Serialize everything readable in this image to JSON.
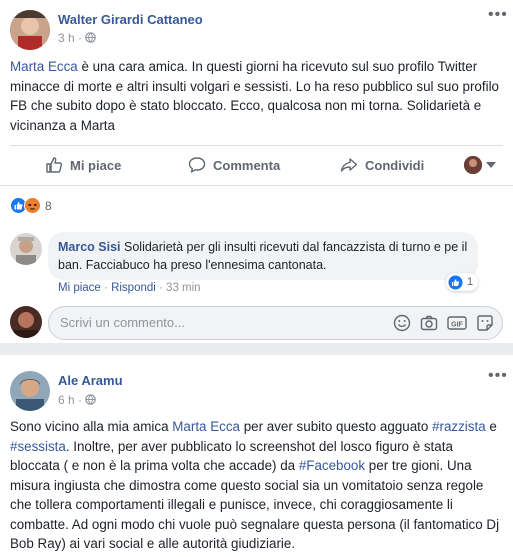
{
  "post1": {
    "author": "Walter Girardi Cattaneo",
    "time": "3 h",
    "mention": "Marta Ecca",
    "body": " è una cara amica. In questi giorni ha ricevuto sul suo profilo Twitter minacce di morte e altri insulti volgari e sessisti. Lo ha reso pubblico sul suo profilo FB che subito dopo è stato bloccato. Ecco, qualcosa non mi torna. Solidarietà e vicinanza a Marta",
    "actions": {
      "like": "Mi piace",
      "comment": "Commenta",
      "share": "Condividi"
    },
    "reaction_count": "8",
    "comment": {
      "author": "Marco Sisi",
      "text": " Solidarietà per gli insulti ricevuti dal fancazzista di turno e pe il ban. Facciabuco ha preso l'ennesima cantonata.",
      "like_label": "Mi piace",
      "reply_label": "Rispondi",
      "time": "33 min",
      "like_count": "1"
    },
    "comment_placeholder": "Scrivi un commento..."
  },
  "post2": {
    "author": "Ale Aramu",
    "time": "6 h",
    "parts": [
      "Sono vicino alla mia amica ",
      "Marta Ecca",
      " per aver subito questo agguato ",
      "#razzista",
      " e ",
      "#sessista",
      ". Inoltre, per aver pubblicato lo screenshot del losco figuro è stata bloccata ( e non è la prima volta che accade) da ",
      "#Facebook",
      " per tre gioni. Una misura ingiusta che dimostra come questo social sia un vomitatoio senza regole che tollera comportamenti illegali e punisce, invece, chi coraggiosamente li combatte. Ad ogni modo chi vuole può segnalare questa persona (il fantomatico Dj Bob Ray) ai vari social e alle autorità giudiziarie."
    ]
  },
  "icons": [
    "globe-icon",
    "more-icon",
    "thumbs-up-icon",
    "comment-icon",
    "share-icon",
    "like-reaction-icon",
    "angry-reaction-icon",
    "emoji-icon",
    "camera-icon",
    "gif-icon",
    "sticker-icon"
  ],
  "colors": {
    "link": "#365899",
    "like_blue": "#1877f2",
    "angry": "#f0b429"
  }
}
